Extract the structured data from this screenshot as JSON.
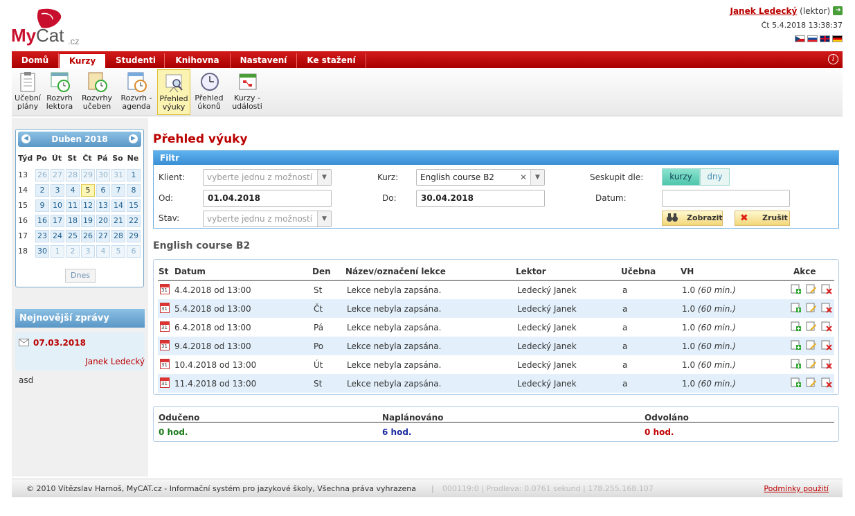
{
  "header": {
    "logo_text": "MyCat.cz",
    "user_name": "Janek Ledecký",
    "user_role": "(lektor)",
    "datetime": "Čt 5.4.2018 13:38:37",
    "flags": [
      "cz",
      "sk",
      "gb",
      "de"
    ]
  },
  "tabs": [
    {
      "label": "Domů",
      "active": false
    },
    {
      "label": "Kurzy",
      "active": true
    },
    {
      "label": "Studenti",
      "active": false
    },
    {
      "label": "Knihovna",
      "active": false
    },
    {
      "label": "Nastavení",
      "active": false
    },
    {
      "label": "Ke stažení",
      "active": false
    }
  ],
  "toolbar": [
    {
      "line1": "Učební",
      "line2": "plány",
      "icon": "clipboard-icon"
    },
    {
      "line1": "Rozvrh",
      "line2": "lektora",
      "icon": "calendar-clock-icon"
    },
    {
      "line1": "Rozvrhy",
      "line2": "učeben",
      "icon": "board-clock-icon"
    },
    {
      "line1": "Rozvrh -",
      "line2": "agenda",
      "icon": "agenda-clock-icon"
    },
    {
      "line1": "Přehled",
      "line2": "výuky",
      "icon": "presentation-search-icon"
    },
    {
      "line1": "Přehled",
      "line2": "úkonů",
      "icon": "clock-icon"
    },
    {
      "line1": "Kurzy -",
      "line2": "události",
      "icon": "calendar-events-icon"
    }
  ],
  "calendar": {
    "month": "Duben 2018",
    "weekday_headers": [
      "Týd",
      "Po",
      "Út",
      "St",
      "Čt",
      "Pá",
      "So",
      "Ne"
    ],
    "weeks": [
      {
        "week": "13",
        "days": [
          "26",
          "27",
          "28",
          "29",
          "30",
          "31",
          "1"
        ]
      },
      {
        "week": "14",
        "days": [
          "2",
          "3",
          "4",
          "5",
          "6",
          "7",
          "8"
        ]
      },
      {
        "week": "15",
        "days": [
          "9",
          "10",
          "11",
          "12",
          "13",
          "14",
          "15"
        ]
      },
      {
        "week": "16",
        "days": [
          "16",
          "17",
          "18",
          "19",
          "20",
          "21",
          "22"
        ]
      },
      {
        "week": "17",
        "days": [
          "23",
          "24",
          "25",
          "26",
          "27",
          "28",
          "29"
        ]
      },
      {
        "week": "18",
        "days": [
          "30",
          "1",
          "2",
          "3",
          "4",
          "5",
          "6"
        ]
      }
    ],
    "today_label": "Dnes"
  },
  "news": {
    "title": "Nejnovější zprávy",
    "date": "07.03.2018",
    "author": "Janek Ledecký",
    "text": "asd"
  },
  "page_title": "Přehled výuky",
  "filter": {
    "title": "Filtr",
    "client_label": "Klient:",
    "client_placeholder": "vyberte jednu z možností",
    "course_label": "Kurz:",
    "course_value": "English course B2",
    "group_label": "Seskupit dle:",
    "group_options": [
      "kurzy",
      "dny"
    ],
    "from_label": "Od:",
    "from_value": "01.04.2018",
    "to_label": "Do:",
    "to_value": "30.04.2018",
    "date_label": "Datum:",
    "date_value": "",
    "state_label": "Stav:",
    "state_placeholder": "vyberte jednu z možností",
    "show_button": "Zobrazit",
    "cancel_button": "Zrušit"
  },
  "group_title": "English course B2",
  "table": {
    "headers": [
      "St",
      "Datum",
      "Den",
      "Název/označení lekce",
      "Lektor",
      "Učebna",
      "VH",
      "Akce"
    ],
    "rows": [
      {
        "date": "4.4.2018 od 13:00",
        "day": "St",
        "name": "Lekce nebyla zapsána.",
        "lector": "Ledecký Janek",
        "room": "a",
        "vh": "1.0",
        "vh_note": "(60 min.)"
      },
      {
        "date": "5.4.2018 od 13:00",
        "day": "Čt",
        "name": "Lekce nebyla zapsána.",
        "lector": "Ledecký Janek",
        "room": "a",
        "vh": "1.0",
        "vh_note": "(60 min.)"
      },
      {
        "date": "6.4.2018 od 13:00",
        "day": "Pá",
        "name": "Lekce nebyla zapsána.",
        "lector": "Ledecký Janek",
        "room": "a",
        "vh": "1.0",
        "vh_note": "(60 min.)"
      },
      {
        "date": "9.4.2018 od 13:00",
        "day": "Po",
        "name": "Lekce nebyla zapsána.",
        "lector": "Ledecký Janek",
        "room": "a",
        "vh": "1.0",
        "vh_note": "(60 min.)"
      },
      {
        "date": "10.4.2018 od 13:00",
        "day": "Út",
        "name": "Lekce nebyla zapsána.",
        "lector": "Ledecký Janek",
        "room": "a",
        "vh": "1.0",
        "vh_note": "(60 min.)"
      },
      {
        "date": "11.4.2018 od 13:00",
        "day": "St",
        "name": "Lekce nebyla zapsána.",
        "lector": "Ledecký Janek",
        "room": "a",
        "vh": "1.0",
        "vh_note": "(60 min.)"
      }
    ]
  },
  "summary": {
    "taught_label": "Odučeno",
    "taught_value": "0 hod.",
    "planned_label": "Naplánováno",
    "planned_value": "6 hod.",
    "cancelled_label": "Odvoláno",
    "cancelled_value": "0 hod."
  },
  "footer": {
    "copyright": "© 2010 Vítězslav Harnoš, MyCAT.cz - Informační systém pro jazykové školy, Všechna práva vyhrazena",
    "stats": "000119:0  |  Prodleva: 0.0761 sekund  |  178.255.168.107",
    "terms_link": "Podmínky použití"
  },
  "colors": {
    "brand_red": "#c00000",
    "accent_blue": "#3a8fd4",
    "taught": "#1a7a1a",
    "planned": "#1a2aa0",
    "cancelled": "#c00000"
  }
}
